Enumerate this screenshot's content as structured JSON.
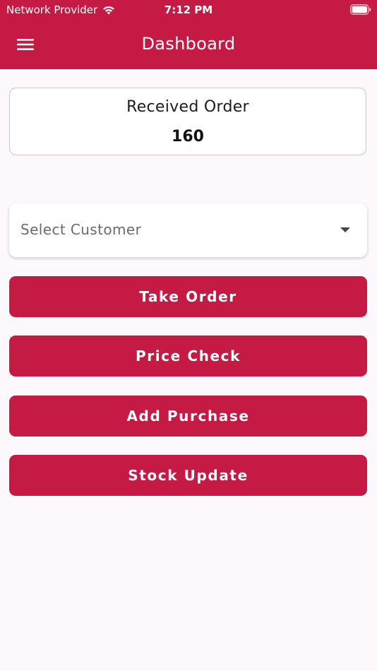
{
  "status_bar": {
    "carrier": "Network Provider",
    "time": "7:12 PM"
  },
  "header": {
    "title": "Dashboard",
    "menu_icon": "hamburger-menu-icon",
    "background": "#c51a44"
  },
  "order_card": {
    "title": "Received Order",
    "count": "160"
  },
  "customer_select": {
    "placeholder": "Select Customer",
    "icon": "dropdown-arrow-icon"
  },
  "actions": [
    {
      "label": "Take Order"
    },
    {
      "label": "Price Check"
    },
    {
      "label": "Add Purchase"
    },
    {
      "label": "Stock Update"
    }
  ],
  "colors": {
    "accent": "#c51a44",
    "page_background": "#fdf8fc"
  }
}
